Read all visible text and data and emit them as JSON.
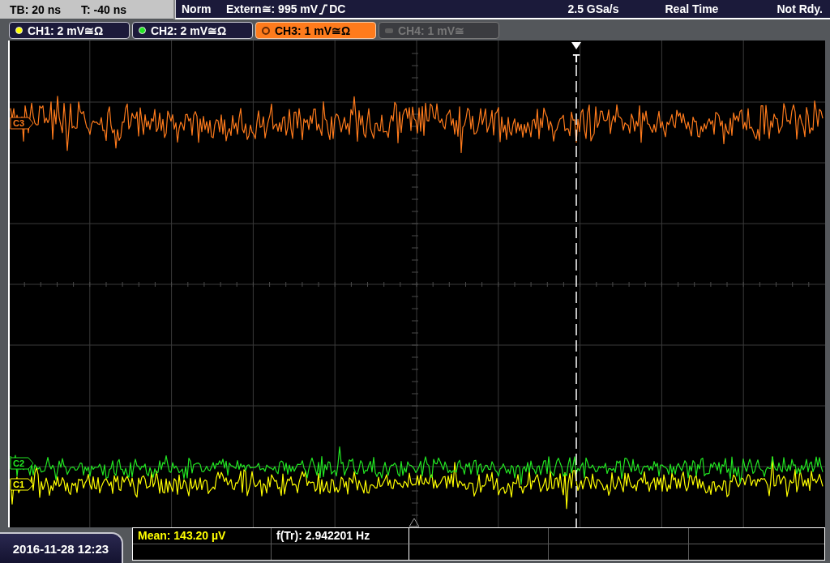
{
  "status_bar": {
    "timebase": "TB: 20 ns",
    "trigger_offset": "T: -40 ns",
    "trigger_mode": "Norm",
    "trigger_source": "Extern≅: 995 mV",
    "rising_edge": true,
    "trigger_coupling": "DC",
    "sample_rate": "2.5 GSa/s",
    "acquisition": "Real Time",
    "status": "Not Rdy."
  },
  "channels": [
    {
      "label": "CH1: 2 mV≅Ω",
      "color": "#ffff00",
      "selected": false,
      "disabled": false
    },
    {
      "label": "CH2: 2 mV≅Ω",
      "color": "#22e622",
      "selected": false,
      "disabled": false
    },
    {
      "label": "CH3: 1 mV≅Ω",
      "color": "#ff7b1c",
      "selected": true,
      "disabled": false
    },
    {
      "label": "CH4: 1 mV≅",
      "color": "#5e5e5e",
      "selected": false,
      "disabled": true
    }
  ],
  "display": {
    "trigger_label": "T",
    "channel_markers": [
      {
        "label": "C3",
        "color": "#ff7b1c"
      },
      {
        "label": "C2",
        "color": "#22e622"
      },
      {
        "label": "C1",
        "color": "#ffff00"
      }
    ]
  },
  "measurements": [
    {
      "text": "Mean: 143.20 µV",
      "color": "#ffff00"
    },
    {
      "text": "f(Tr): 2.942201 Hz",
      "color": "#ffffff"
    }
  ],
  "date_time": "2016-11-28 12:23"
}
